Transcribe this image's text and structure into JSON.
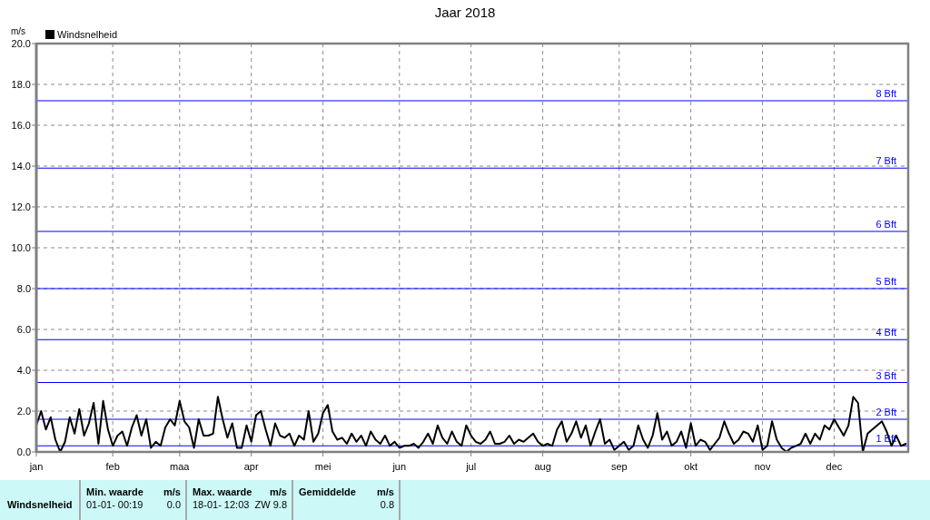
{
  "chart": {
    "chart_data": {
      "type": "line",
      "title": "Jaar 2018",
      "ylabel": "m/s",
      "grid": true,
      "categories": [
        "jan",
        null,
        null,
        null,
        null,
        null,
        null,
        null,
        null,
        null,
        null,
        null,
        null,
        null,
        null,
        null,
        "feb",
        null,
        null,
        null,
        null,
        null,
        null,
        null,
        null,
        null,
        null,
        null,
        null,
        null,
        "maa",
        null,
        null,
        null,
        null,
        null,
        null,
        null,
        null,
        null,
        null,
        null,
        null,
        null,
        null,
        "apr",
        null,
        null,
        null,
        null,
        null,
        null,
        null,
        null,
        null,
        null,
        null,
        null,
        null,
        null,
        "mei",
        null,
        null,
        null,
        null,
        null,
        null,
        null,
        null,
        null,
        null,
        null,
        null,
        null,
        null,
        null,
        "jun",
        null,
        null,
        null,
        null,
        null,
        null,
        null,
        null,
        null,
        null,
        null,
        null,
        null,
        null,
        "jul",
        null,
        null,
        null,
        null,
        null,
        null,
        null,
        null,
        null,
        null,
        null,
        null,
        null,
        null,
        "aug",
        null,
        null,
        null,
        null,
        null,
        null,
        null,
        null,
        null,
        null,
        null,
        null,
        null,
        null,
        null,
        "sep",
        null,
        null,
        null,
        null,
        null,
        null,
        null,
        null,
        null,
        null,
        null,
        null,
        null,
        null,
        "okt",
        null,
        null,
        null,
        null,
        null,
        null,
        null,
        null,
        null,
        null,
        null,
        null,
        null,
        null,
        "nov",
        null,
        null,
        null,
        null,
        null,
        null,
        null,
        null,
        null,
        null,
        null,
        null,
        null,
        null,
        "dec",
        null,
        null,
        null,
        null,
        null,
        null,
        null,
        null,
        null,
        null,
        null,
        null,
        null,
        null,
        null
      ],
      "series": [
        {
          "name": "Windsnelheid",
          "color": "#000000",
          "values": [
            1.3,
            2.0,
            1.1,
            1.7,
            0.6,
            0.0,
            0.5,
            1.7,
            0.9,
            2.1,
            0.8,
            1.4,
            2.4,
            0.4,
            2.5,
            1.1,
            0.3,
            0.8,
            1.0,
            0.3,
            1.2,
            1.8,
            0.8,
            1.6,
            0.2,
            0.5,
            0.3,
            1.2,
            1.6,
            1.3,
            2.5,
            1.5,
            1.2,
            0.2,
            1.6,
            0.8,
            0.8,
            0.9,
            2.7,
            1.6,
            0.7,
            1.4,
            0.2,
            0.2,
            1.3,
            0.5,
            1.8,
            2.0,
            1.1,
            0.3,
            1.4,
            0.8,
            0.7,
            0.9,
            0.3,
            0.8,
            0.6,
            2.0,
            0.5,
            0.9,
            1.9,
            2.3,
            1.0,
            0.6,
            0.7,
            0.4,
            0.9,
            0.5,
            0.8,
            0.3,
            1.0,
            0.6,
            0.4,
            0.8,
            0.3,
            0.5,
            0.2,
            0.3,
            0.3,
            0.4,
            0.2,
            0.5,
            0.9,
            0.4,
            1.3,
            0.7,
            0.4,
            1.0,
            0.5,
            0.3,
            1.3,
            0.8,
            0.5,
            0.4,
            0.6,
            1.0,
            0.4,
            0.4,
            0.5,
            0.8,
            0.4,
            0.6,
            0.5,
            0.7,
            0.9,
            0.5,
            0.3,
            0.4,
            0.3,
            1.1,
            1.5,
            0.5,
            0.9,
            1.5,
            0.7,
            1.3,
            0.3,
            1.0,
            1.6,
            0.4,
            0.6,
            0.1,
            0.3,
            0.5,
            0.1,
            0.3,
            1.3,
            0.6,
            0.2,
            0.8,
            1.9,
            0.6,
            1.0,
            0.3,
            0.5,
            1.0,
            0.2,
            1.4,
            0.3,
            0.6,
            0.5,
            0.1,
            0.4,
            0.7,
            1.5,
            0.9,
            0.4,
            0.6,
            1.0,
            0.9,
            0.5,
            1.3,
            0.1,
            0.3,
            1.5,
            0.6,
            0.2,
            0.0,
            0.2,
            0.3,
            0.4,
            0.9,
            0.4,
            0.9,
            0.6,
            1.3,
            1.1,
            1.6,
            1.2,
            0.8,
            1.3,
            2.7,
            2.4,
            0.0,
            0.9,
            1.1,
            1.3,
            1.5,
            1.0,
            0.3,
            0.8,
            0.3,
            0.4
          ]
        }
      ],
      "ylim": [
        0,
        20
      ],
      "yticks": [
        {
          "value": 0,
          "label": "0.0"
        },
        {
          "value": 2,
          "label": "2.0"
        },
        {
          "value": 4,
          "label": "4.0"
        },
        {
          "value": 6,
          "label": "6.0"
        },
        {
          "value": 8,
          "label": "8.0"
        },
        {
          "value": 10,
          "label": "10.0"
        },
        {
          "value": 12,
          "label": "12.0"
        },
        {
          "value": 14,
          "label": "14.0"
        },
        {
          "value": 16,
          "label": "16.0"
        },
        {
          "value": 18,
          "label": "18.0"
        },
        {
          "value": 20,
          "label": "20.0"
        }
      ],
      "ref_lines": [
        {
          "axis": "y",
          "value": 17.2,
          "label": "8 Bft"
        },
        {
          "axis": "y",
          "value": 13.9,
          "label": "7 Bft"
        },
        {
          "axis": "y",
          "value": 10.8,
          "label": "6 Bft"
        },
        {
          "axis": "y",
          "value": 8.0,
          "label": "5 Bft"
        },
        {
          "axis": "y",
          "value": 5.5,
          "label": "4 Bft"
        },
        {
          "axis": "y",
          "value": 3.4,
          "label": "3 Bft"
        },
        {
          "axis": "y",
          "value": 1.6,
          "label": "2 Bft"
        },
        {
          "axis": "y",
          "value": 0.3,
          "label": "1 Bft"
        }
      ]
    }
  },
  "stats_panel": {
    "columns": [
      {
        "header": "Min. waarde",
        "unit": "m/s"
      },
      {
        "header": "Max. waarde",
        "unit": "m/s"
      },
      {
        "header": "Gemiddelde",
        "unit": "m/s"
      }
    ],
    "rows": [
      {
        "label": "Windsnelheid",
        "cells": [
          {
            "time": "01-01- 00:19",
            "value": "0.0"
          },
          {
            "time": "18-01- 12:03",
            "direction": "ZW",
            "value": "9.8"
          },
          {
            "value": "0.8"
          }
        ]
      }
    ]
  }
}
